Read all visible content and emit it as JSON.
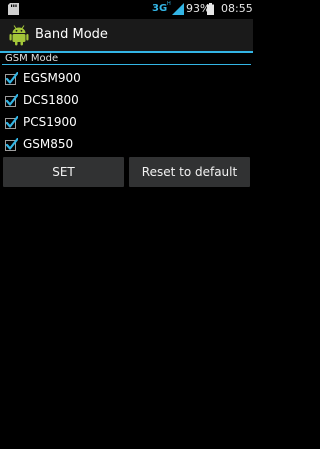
{
  "status_bar": {
    "network_type": "3G",
    "network_sup": "H",
    "battery_percent": "93%",
    "time": "08:55",
    "accent_color": "#33b5e5"
  },
  "action_bar": {
    "title": "Band Mode",
    "icon": "android-icon"
  },
  "section": {
    "header": "GSM Mode"
  },
  "options": [
    {
      "label": "EGSM900",
      "checked": true
    },
    {
      "label": "DCS1800",
      "checked": true
    },
    {
      "label": "PCS1900",
      "checked": true
    },
    {
      "label": "GSM850",
      "checked": true
    }
  ],
  "buttons": {
    "set_label": "SET",
    "reset_label": "Reset to default"
  }
}
